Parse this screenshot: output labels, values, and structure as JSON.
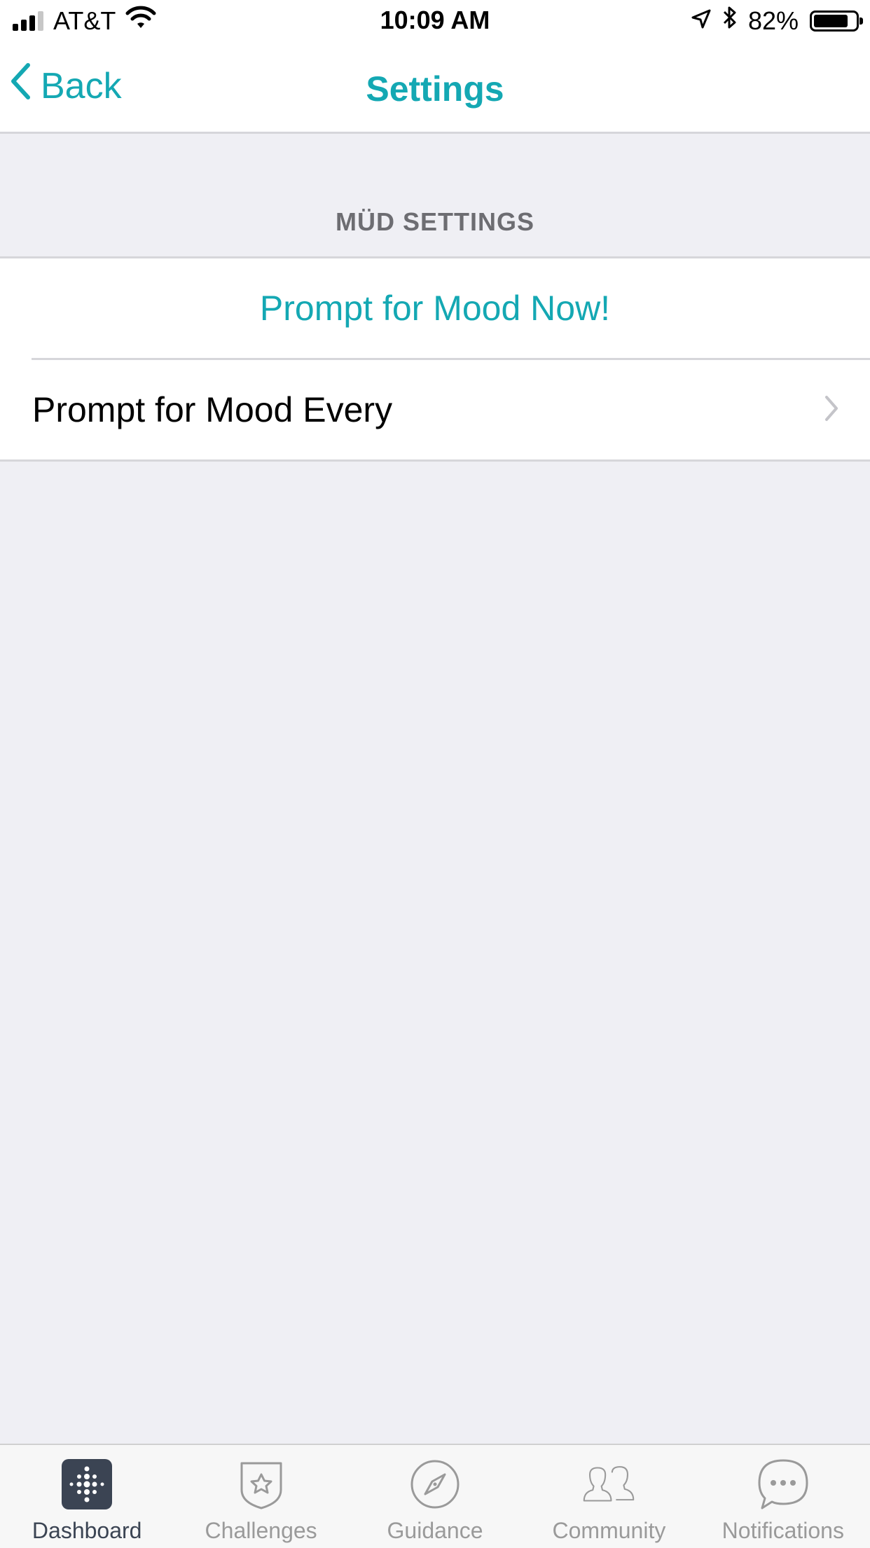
{
  "status_bar": {
    "carrier": "AT&T",
    "time": "10:09 AM",
    "battery": "82%",
    "battery_level": 0.82
  },
  "nav": {
    "back_label": "Back",
    "title": "Settings"
  },
  "section": {
    "header": "MÜD SETTINGS"
  },
  "rows": {
    "prompt_now": "Prompt for Mood Now!",
    "prompt_every": "Prompt for Mood Every"
  },
  "tabs": [
    {
      "label": "Dashboard",
      "icon": "fitbit-dots-icon",
      "active": true
    },
    {
      "label": "Challenges",
      "icon": "star-badge-icon",
      "active": false
    },
    {
      "label": "Guidance",
      "icon": "compass-icon",
      "active": false
    },
    {
      "label": "Community",
      "icon": "people-icon",
      "active": false
    },
    {
      "label": "Notifications",
      "icon": "chat-bubble-icon",
      "active": false
    }
  ],
  "colors": {
    "accent": "#14a8b3",
    "background": "#efeff4",
    "tab_active": "#3b4453",
    "tab_inactive": "#9a9a9a"
  }
}
